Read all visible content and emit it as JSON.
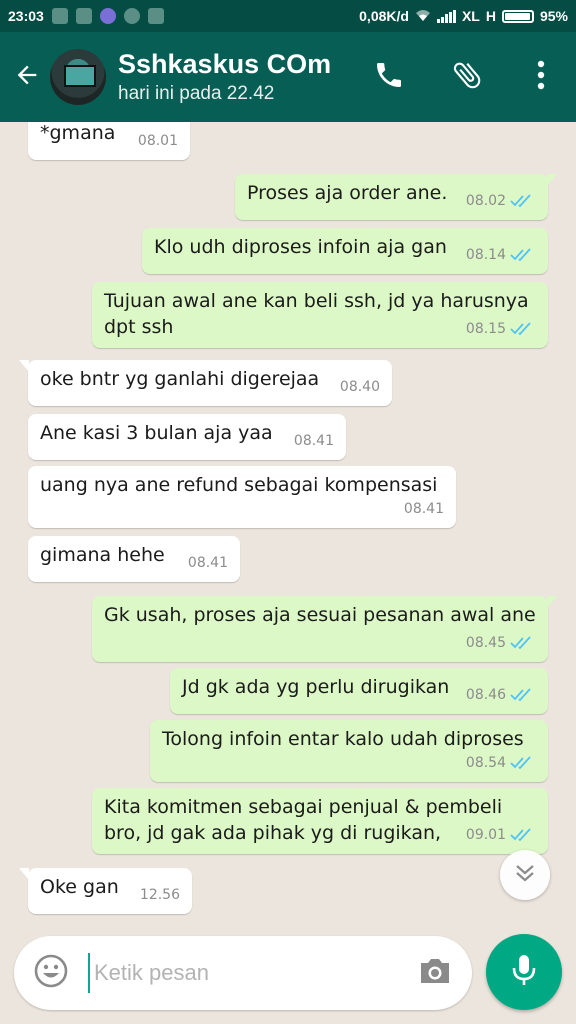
{
  "status_bar": {
    "time": "23:03",
    "speed": "0,08K/d",
    "carrier": "XL",
    "network_type": "H",
    "battery": "95%",
    "battery_level": 0.95,
    "icons": [
      "notification-icon",
      "notification-icon",
      "browser-icon",
      "chat-icon",
      "notification-icon",
      "wifi-icon",
      "signal-icon",
      "battery-icon"
    ]
  },
  "header": {
    "contact_name": "Sshkaskus COm",
    "last_seen": "hari ini pada 22.42",
    "icons": [
      "back-arrow-icon",
      "avatar",
      "phone-icon",
      "attach-icon",
      "more-vert-icon"
    ]
  },
  "messages": [
    {
      "dir": "in",
      "text": "*gmana",
      "time": "08.01"
    },
    {
      "dir": "out",
      "text": "Proses aja order ane.",
      "time": "08.02",
      "read": true
    },
    {
      "dir": "out",
      "text": "Klo udh diproses infoin aja gan",
      "time": "08.14",
      "read": true
    },
    {
      "dir": "out",
      "text": "Tujuan awal ane kan beli ssh, jd ya harusnya dpt ssh",
      "time": "08.15",
      "read": true
    },
    {
      "dir": "in",
      "text": "oke bntr yg ganlahi digerejaa",
      "time": "08.40"
    },
    {
      "dir": "in",
      "text": "Ane kasi 3 bulan aja yaa",
      "time": "08.41"
    },
    {
      "dir": "in",
      "text": "uang nya ane refund sebagai kompensasi",
      "time": "08.41"
    },
    {
      "dir": "in",
      "text": "gimana hehe",
      "time": "08.41"
    },
    {
      "dir": "out",
      "text": "Gk usah, proses aja sesuai pesanan awal ane",
      "time": "08.45",
      "read": true
    },
    {
      "dir": "out",
      "text": "Jd gk ada yg perlu dirugikan",
      "time": "08.46",
      "read": true
    },
    {
      "dir": "out",
      "text": "Tolong infoin entar kalo udah diproses",
      "time": "08.54",
      "read": true
    },
    {
      "dir": "out",
      "text": "Kita komitmen sebagai penjual & pembeli bro, jd gak ada pihak yg di rugikan,",
      "time": "09.01",
      "read": true
    },
    {
      "dir": "in",
      "text": "Oke gan",
      "time": "12.56"
    }
  ],
  "input": {
    "placeholder": "Ketik pesan",
    "value": ""
  },
  "colors": {
    "header": "#075e54",
    "status_bar": "#054d44",
    "outgoing_bubble": "#dcf8c6",
    "incoming_bubble": "#ffffff",
    "chat_background": "#ece5dd",
    "read_tick": "#4fc3f7",
    "mic_button": "#00a884"
  }
}
